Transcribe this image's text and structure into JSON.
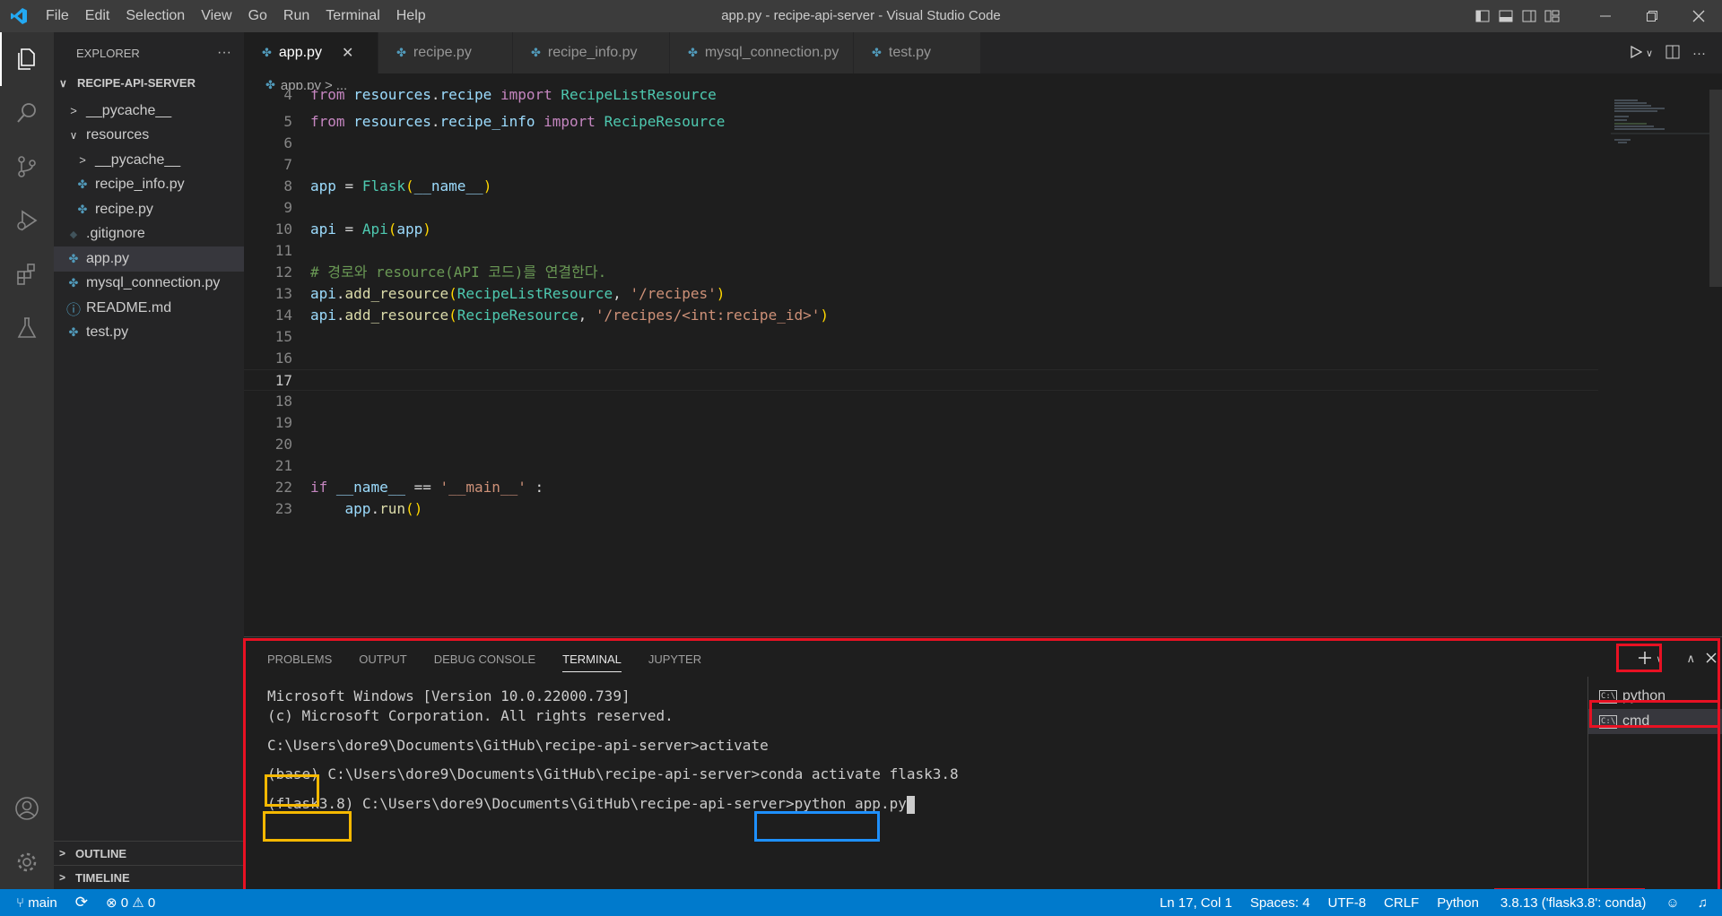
{
  "window": {
    "title": "app.py - recipe-api-server - Visual Studio Code",
    "menu": [
      "File",
      "Edit",
      "Selection",
      "View",
      "Go",
      "Run",
      "Terminal",
      "Help"
    ]
  },
  "sidebar": {
    "header": "EXPLORER",
    "more": "···",
    "root": "RECIPE-API-SERVER",
    "items": [
      {
        "label": "__pycache__",
        "kind": "folder-collapsed",
        "indent": 1
      },
      {
        "label": "resources",
        "kind": "folder-open",
        "indent": 1
      },
      {
        "label": "__pycache__",
        "kind": "folder-collapsed",
        "indent": 2
      },
      {
        "label": "recipe_info.py",
        "kind": "py",
        "indent": 2
      },
      {
        "label": "recipe.py",
        "kind": "py",
        "indent": 2
      },
      {
        "label": ".gitignore",
        "kind": "git",
        "indent": 1
      },
      {
        "label": "app.py",
        "kind": "py",
        "indent": 1
      },
      {
        "label": "mysql_connection.py",
        "kind": "py",
        "indent": 1
      },
      {
        "label": "README.md",
        "kind": "info",
        "indent": 1
      },
      {
        "label": "test.py",
        "kind": "py",
        "indent": 1
      }
    ],
    "outline": "OUTLINE",
    "timeline": "TIMELINE"
  },
  "tabs": [
    {
      "label": "app.py",
      "close": "✕"
    },
    {
      "label": "recipe.py"
    },
    {
      "label": "recipe_info.py"
    },
    {
      "label": "mysql_connection.py"
    },
    {
      "label": "test.py"
    }
  ],
  "breadcrumb": {
    "file": "app.py",
    "sep": ">",
    "rest": "..."
  },
  "editor": {
    "line4_num": "4",
    "line5_num": "5",
    "line6_num": "6",
    "line7_num": "7",
    "line8_num": "8",
    "line9_num": "9",
    "line10_num": "10",
    "line11_num": "11",
    "line12_num": "12",
    "line13_num": "13",
    "line14_num": "14",
    "line15_num": "15",
    "line16_num": "16",
    "line17_num": "17",
    "line18_num": "18",
    "line19_num": "19",
    "line20_num": "20",
    "line21_num": "21",
    "line22_num": "22",
    "line23_num": "23",
    "tokens": {
      "from": "from",
      "import": "import",
      "resources": "resources",
      "dot": ".",
      "recipe": "recipe",
      "recipe_info": "recipe_info",
      "RecipeListResource": "RecipeListResource",
      "RecipeResource": "RecipeResource",
      "app": "app",
      "eq": " = ",
      "Flask": "Flask",
      "name": "__name__",
      "api": "api",
      "Api": "Api",
      "lp": "(",
      "rp": ")",
      "comment": "# 경로와 resource(API 코드)를 연결한다.",
      "add_resource": "add_resource",
      "comma": ", ",
      "recipes": "'/recipes'",
      "recipes_id": "'/recipes/<int:recipe_id>'",
      "if": "if",
      "eqeq": " == ",
      "main": "'__main__'",
      "colon": " :",
      "run": "run"
    }
  },
  "panel": {
    "tabs": [
      "PROBLEMS",
      "OUTPUT",
      "DEBUG CONSOLE",
      "TERMINAL",
      "JUPYTER"
    ],
    "active_tab": "TERMINAL",
    "terminal_lines": {
      "l1": "Microsoft Windows [Version 10.0.22000.739]",
      "l2": "(c) Microsoft Corporation. All rights reserved.",
      "l3": "C:\\Users\\dore9\\Documents\\GitHub\\recipe-api-server>activate",
      "l4_env": "(base)",
      "l4_rest": " C:\\Users\\dore9\\Documents\\GitHub\\recipe-api-server>conda activate flask3.8",
      "l5_env": "(flask3.8)",
      "l5_path": " C:\\Users\\dore9\\Documents\\GitHub\\recipe-api-server>",
      "l5_cmd": "python app.py"
    },
    "terminals": [
      "python",
      "cmd"
    ],
    "terminal_icon_text": "C:\\"
  },
  "statusbar": {
    "branch": "main",
    "errors": "0",
    "warnings": "0",
    "position": "Ln 17, Col 1",
    "spaces": "Spaces: 4",
    "encoding": "UTF-8",
    "eol": "CRLF",
    "language": "Python",
    "interpreter": "3.8.13 ('flask3.8': conda)"
  },
  "colors": {
    "accent": "#007acc",
    "annotation_red": "#e81123",
    "annotation_yellow": "#f5b800",
    "annotation_blue": "#1e90ff"
  }
}
